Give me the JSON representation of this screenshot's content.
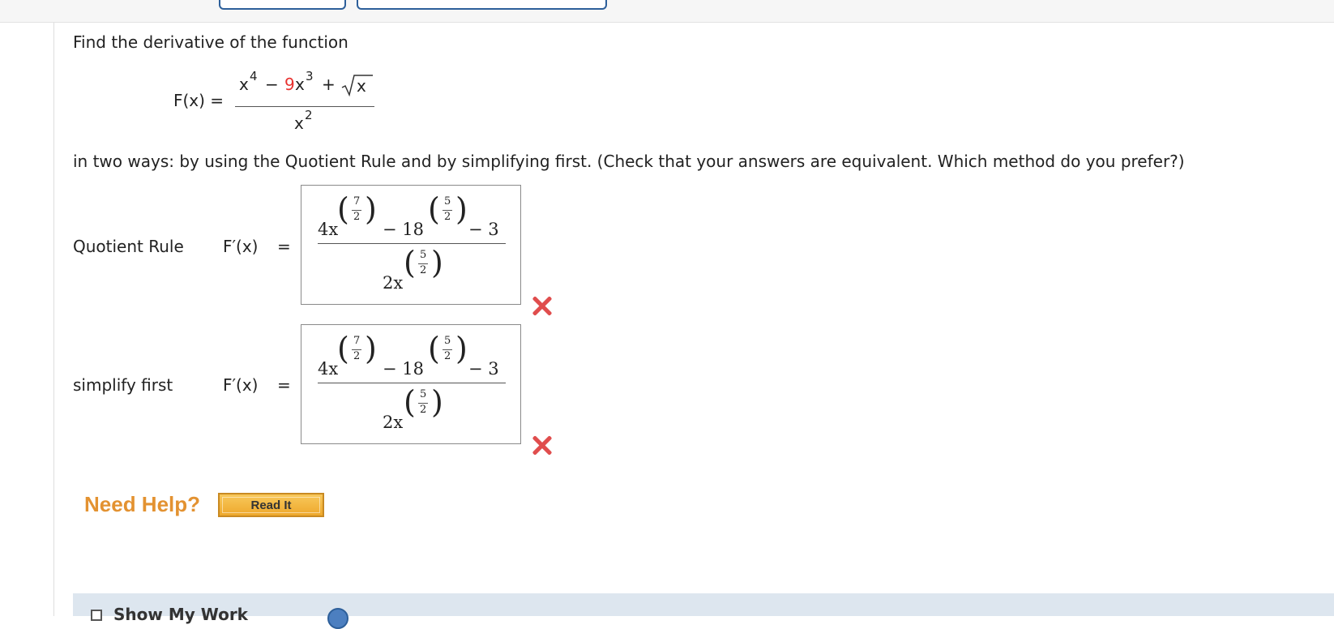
{
  "problem": {
    "intro": "Find the derivative of the function",
    "function_name": "F(x) =",
    "numerator_x4": "x",
    "exp4": "4",
    "minus": "−",
    "coef_red": "9",
    "x3": "x",
    "exp3": "3",
    "plus": "+",
    "sqrt_arg": "x",
    "denominator_x": "x",
    "exp2": "2",
    "instructions": "in two ways: by using the Quotient Rule and by simplifying first. (Check that your answers are equivalent. Which method do you prefer?)"
  },
  "answers": [
    {
      "label": "Quotient Rule",
      "fprime": "F′(x)",
      "equals": "=",
      "num_term1": "4x",
      "exp1_num": "7",
      "exp1_den": "2",
      "num_mid": "− 18",
      "exp2_num": "5",
      "exp2_den": "2",
      "num_end": "− 3",
      "den_term": "2x",
      "den_exp_num": "5",
      "den_exp_den": "2",
      "status": "incorrect"
    },
    {
      "label": "simplify first",
      "fprime": "F′(x)",
      "equals": "=",
      "num_term1": "4x",
      "exp1_num": "7",
      "exp1_den": "2",
      "num_mid": "− 18",
      "exp2_num": "5",
      "exp2_den": "2",
      "num_end": "− 3",
      "den_term": "2x",
      "den_exp_num": "5",
      "den_exp_den": "2",
      "status": "incorrect"
    }
  ],
  "help": {
    "need_help": "Need Help?",
    "read_it": "Read It"
  },
  "show_work": {
    "label": "Show My Work"
  },
  "colors": {
    "accent_red": "#e8312f",
    "incorrect_mark": "#e04d4d",
    "need_help_orange": "#e39231",
    "top_button_border": "#2d5f9a"
  }
}
